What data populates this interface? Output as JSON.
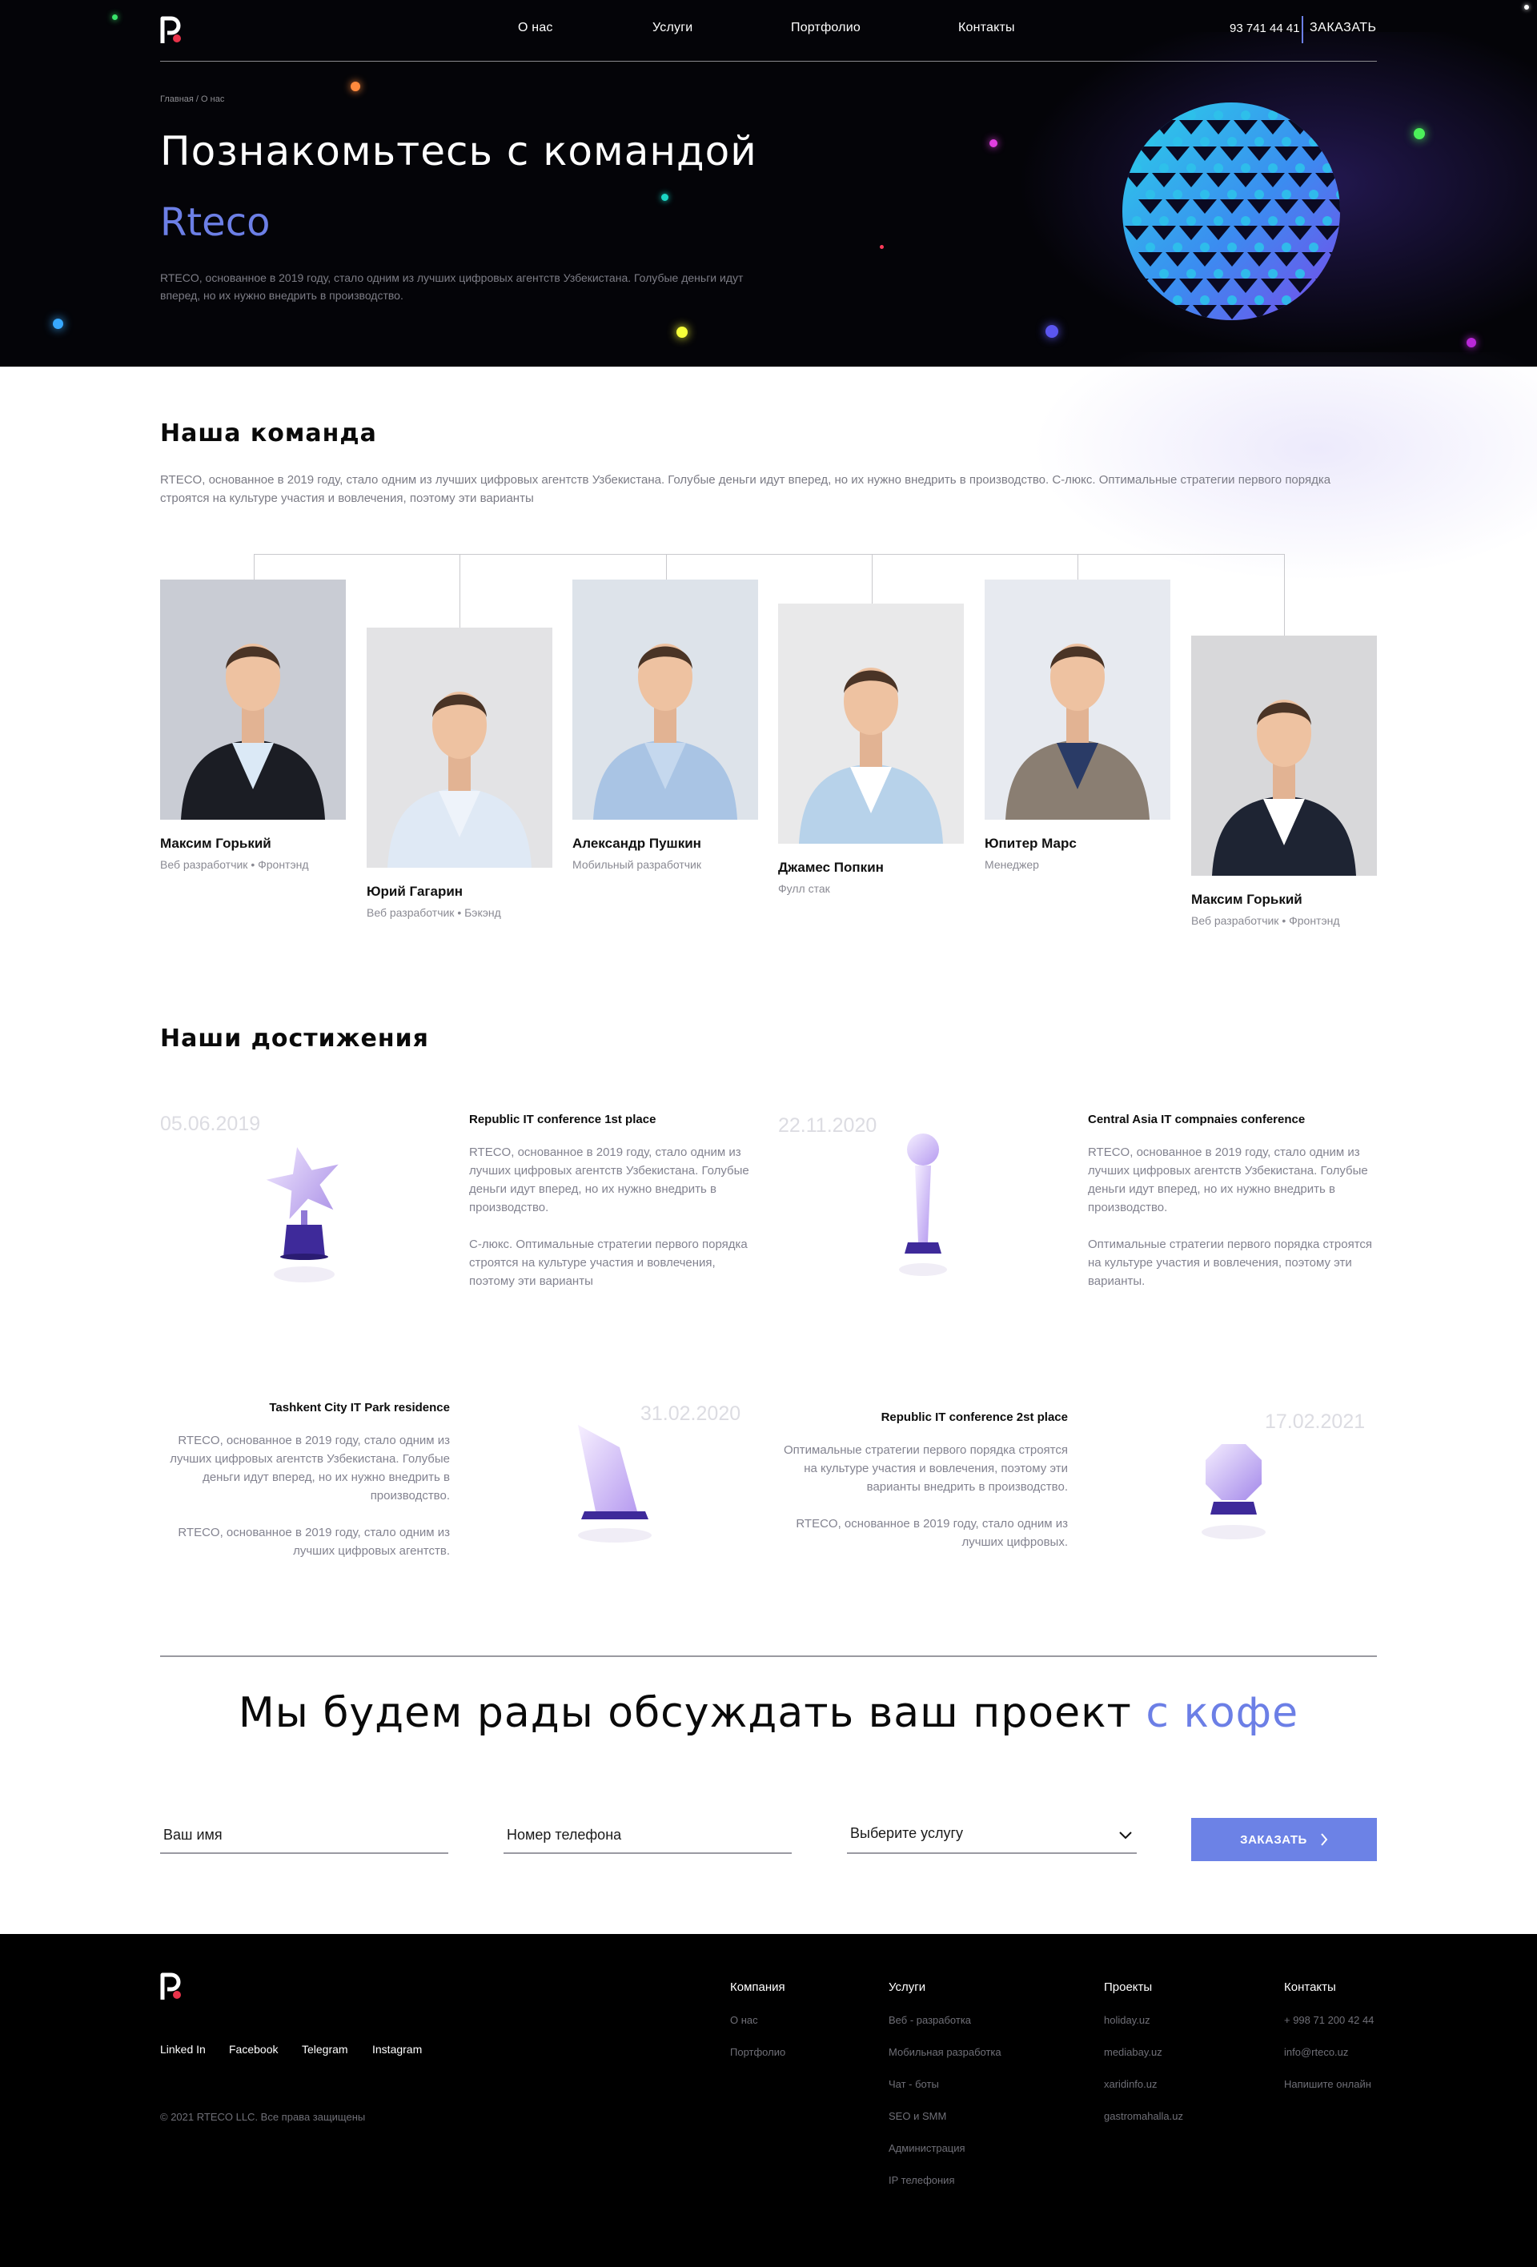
{
  "header": {
    "nav": [
      "О нас",
      "Услуги",
      "Портфолио",
      "Контакты"
    ],
    "phone": "93 741 44 41",
    "order_label": "ЗАКАЗАТЬ"
  },
  "hero": {
    "breadcrumb": "Главная / О нас",
    "title": "Познакомьтесь с командой",
    "brand": "Rteco",
    "text": "RTECO, основанное в 2019 году, стало одним из лучших цифровых агентств Узбекистана. Голубые деньги идут вперед, но их нужно внедрить в производство."
  },
  "team": {
    "title": "Наша команда",
    "text": "RTECO, основанное в 2019 году, стало одним из лучших цифровых агентств Узбекистана. Голубые деньги идут вперед, но их нужно внедрить в производство. С-люкс. Оптимальные стратегии первого порядка строятся на культуре участия и вовлечения, поэтому эти варианты",
    "members": [
      {
        "name": "Максим Горький",
        "role": "Веб разработчик • Фронтэнд"
      },
      {
        "name": "Юрий Гагарин",
        "role": "Веб разработчик • Бэкэнд"
      },
      {
        "name": "Александр Пушкин",
        "role": "Мобильный разработчик"
      },
      {
        "name": "Джамес Попкин",
        "role": "Фулл стак"
      },
      {
        "name": "Юпитер Марс",
        "role": "Менеджер"
      },
      {
        "name": "Максим Горький",
        "role": "Веб разработчик • Фронтэнд"
      }
    ]
  },
  "achievements": {
    "title": "Наши достижения",
    "items": [
      {
        "date": "05.06.2019",
        "title": "Republic IT conference 1st place",
        "p1": "RTECO, основанное в 2019 году, стало одним из лучших цифровых агентств Узбекистана. Голубые деньги идут вперед, но их нужно внедрить в производство.",
        "p2": "С-люкс. Оптимальные стратегии первого порядка строятся на культуре участия и вовлечения, поэтому эти варианты"
      },
      {
        "date": "22.11.2020",
        "title": "Central Asia IT compnaies conference",
        "p1": "RTECO, основанное в 2019 году, стало одним из лучших цифровых агентств Узбекистана. Голубые деньги идут вперед, но их нужно внедрить в производство.",
        "p2": "Оптимальные стратегии первого порядка строятся на культуре участия и вовлечения, поэтому эти варианты."
      },
      {
        "date": "31.02.2020",
        "title": "Tashkent City IT Park residence",
        "p1": "RTECO, основанное в 2019 году, стало одним из лучших цифровых агентств Узбекистана. Голубые деньги идут вперед, но их нужно внедрить в производство.",
        "p2": "RTECO, основанное в 2019 году, стало одним из лучших цифровых агентств."
      },
      {
        "date": "17.02.2021",
        "title": "Republic IT conference 2st place",
        "p1": "Оптимальные стратегии первого порядка строятся на культуре участия и вовлечения, поэтому эти варианты  внедрить в производство.",
        "p2": "RTECO, основанное в 2019 году, стало одним из лучших цифровых."
      }
    ]
  },
  "cta": {
    "title_main": "Мы будем рады обсуждать ваш проект",
    "title_accent": "с кофе",
    "name_placeholder": "Ваш имя",
    "phone_placeholder": "Номер телефона",
    "service_placeholder": "Выберите услугу",
    "button_label": "ЗАКАЗАТЬ"
  },
  "footer": {
    "socials": [
      "Linked In",
      "Facebook",
      "Telegram",
      "Instagram"
    ],
    "copyright": "© 2021 RTECO LLC. Все права защищены",
    "columns": [
      {
        "title": "Компания",
        "items": [
          "О нас",
          "Портфолио"
        ]
      },
      {
        "title": "Услуги",
        "items": [
          "Веб - разработка",
          "Мобильная разработка",
          "Чат - боты",
          "SEO и SMM",
          "Администрация",
          "IP телефония"
        ]
      },
      {
        "title": "Проекты",
        "items": [
          "holiday.uz",
          "mediabay.uz",
          "xaridinfo.uz",
          "gastromahalla.uz"
        ]
      },
      {
        "title": "Контакты",
        "items": [
          "+ 998 71 200 42 44",
          "info@rteco.uz",
          "Напишите онлайн"
        ]
      }
    ]
  },
  "colors": {
    "accent": "#6c7fe6",
    "brand_red": "#e8334a",
    "hero_bg": "#040408",
    "footer_bg": "#000000"
  }
}
